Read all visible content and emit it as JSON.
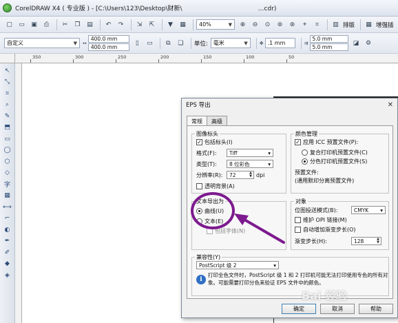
{
  "window": {
    "title_start": "CorelDRAW X4 ( 专业版 ) - [C:\\Users\\123\\Desktop\\",
    "title_partial": "财新\\",
    "title_end": "…cdr)"
  },
  "toolbar1": {
    "zoom": "40%",
    "launch_label": "排版",
    "snap_label": "增强插"
  },
  "toolbar2": {
    "preset": "自定义",
    "width": "400.0 mm",
    "height": "400.0 mm",
    "units_label": "单位:",
    "units_value": "毫米",
    "nudge": ".1 mm",
    "dup_x": "5.0 mm",
    "dup_y": "5.0 mm"
  },
  "ruler": {
    "ticks": [
      "350",
      "300",
      "250",
      "200",
      "150",
      "100",
      "50"
    ]
  },
  "dialog": {
    "title": "EPS 导出",
    "tabs": [
      "常规",
      "高级"
    ],
    "image_header": {
      "legend": "图像标头",
      "include_label": "包括标头(I)",
      "format_label": "格式(F):",
      "format_value": "Tiff",
      "type_label": "类型(T):",
      "type_value": "8 位彩色",
      "resolution_label": "分辨率(R):",
      "resolution_value": "72",
      "resolution_unit": "dpi",
      "transparent_label": "透明背景(A)"
    },
    "color_mgmt": {
      "legend": "颜色管理",
      "apply_icc_label": "应用 ICC 预置文件(P):",
      "composite_label": "复合打印机预置文件(C)",
      "separation_label": "分色打印机预置文件(S)",
      "profile_label": "预置文件:",
      "profile_value": "(通用默印分离预置文件)"
    },
    "text_export": {
      "legend": "文本导出为",
      "curves_label": "曲线(U)",
      "text_label": "文本(E)",
      "fonts_label": "包括字体(N)"
    },
    "objects": {
      "legend": "对象",
      "bitmap_mode_label": "位图投送模式(B):",
      "bitmap_mode_value": "CMYK",
      "opi_label": "维护 OPI 链接(M)",
      "fountain_label": "自动增加渐变步长(O)",
      "fountain_steps_label": "渐变步长(H):",
      "fountain_steps_value": "128"
    },
    "compat": {
      "legend": "兼容性(Y)",
      "value": "PostScript 级 2",
      "info": "打印全色文件时，PostScript 级 1 和 2 打印机可能无法打印使用专色的所有对象。可能需要打印分色来验证 EPS 文件中的颜色。"
    },
    "buttons": {
      "ok": "确定",
      "cancel": "取消",
      "help": "帮助"
    }
  },
  "watermark": "Bai 经验",
  "colors": {
    "annotation": "#7d1a8f",
    "info_blue": "#2f6fc4"
  }
}
